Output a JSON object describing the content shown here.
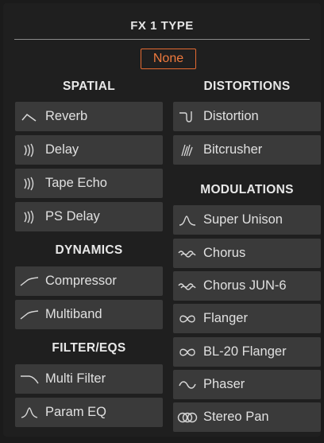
{
  "header": {
    "title": "FX 1 TYPE",
    "selected": "None"
  },
  "left_column": {
    "spatial": {
      "heading": "SPATIAL",
      "items": [
        {
          "label": "Reverb",
          "icon": "reverb-icon"
        },
        {
          "label": "Delay",
          "icon": "delay-icon"
        },
        {
          "label": "Tape Echo",
          "icon": "delay-icon"
        },
        {
          "label": "PS Delay",
          "icon": "delay-icon"
        }
      ]
    },
    "dynamics": {
      "heading": "DYNAMICS",
      "items": [
        {
          "label": "Compressor",
          "icon": "compressor-icon"
        },
        {
          "label": "Multiband",
          "icon": "compressor-icon"
        }
      ]
    },
    "filters": {
      "heading": "FILTER/EQS",
      "items": [
        {
          "label": "Multi Filter",
          "icon": "filter-icon"
        },
        {
          "label": "Param EQ",
          "icon": "param-eq-icon"
        }
      ]
    }
  },
  "right_column": {
    "distortions": {
      "heading": "DISTORTIONS",
      "items": [
        {
          "label": "Distortion",
          "icon": "distortion-icon"
        },
        {
          "label": "Bitcrusher",
          "icon": "bitcrusher-icon"
        }
      ]
    },
    "modulations": {
      "heading": "MODULATIONS",
      "items": [
        {
          "label": "Super Unison",
          "icon": "unison-icon"
        },
        {
          "label": "Chorus",
          "icon": "chorus-icon"
        },
        {
          "label": "Chorus JUN-6",
          "icon": "chorus-icon"
        },
        {
          "label": "Flanger",
          "icon": "flanger-icon"
        },
        {
          "label": "BL-20 Flanger",
          "icon": "flanger-icon"
        },
        {
          "label": "Phaser",
          "icon": "phaser-icon"
        },
        {
          "label": "Stereo Pan",
          "icon": "stereo-pan-icon"
        }
      ]
    }
  },
  "colors": {
    "accent": "#f07a3d",
    "item_bg": "#3a3a3a",
    "panel_bg": "#1f1f1f"
  }
}
